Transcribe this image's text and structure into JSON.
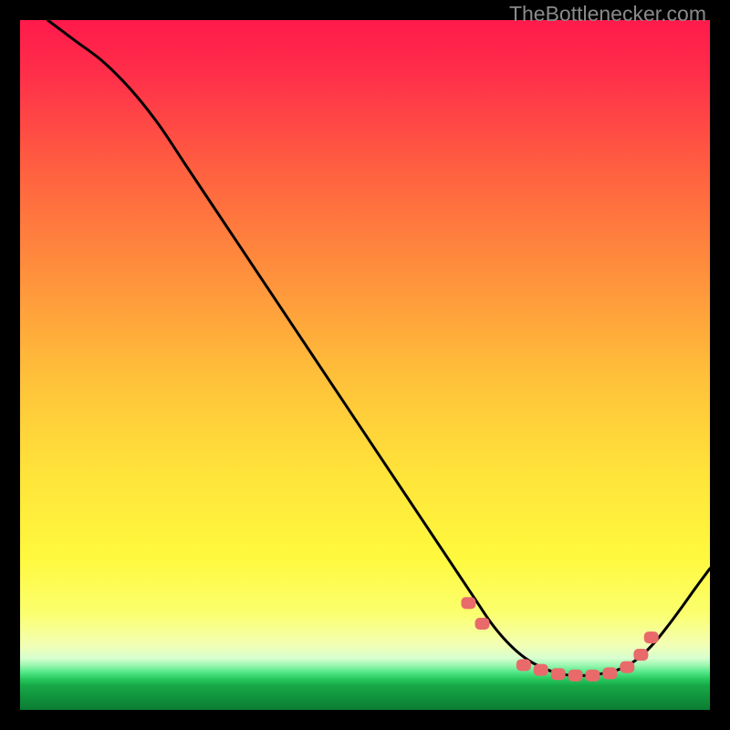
{
  "watermark": "TheBottlenecker.com",
  "colors": {
    "bg": "#000000",
    "grad_top": "#ff1a4b",
    "grad_mid1": "#ff6b3d",
    "grad_mid2": "#ffd23a",
    "grad_mid3": "#fff93e",
    "grad_low": "#f6ffc2",
    "grad_band": "#2fe07a",
    "grad_bottom": "#0c8f3e",
    "curve": "#000000",
    "markers": "#e96a6a"
  },
  "chart_data": {
    "type": "line",
    "title": "",
    "xlabel": "",
    "ylabel": "",
    "xlim": [
      0,
      100
    ],
    "ylim": [
      0,
      100
    ],
    "grid": false,
    "series": [
      {
        "name": "bottleneck-curve",
        "x": [
          4,
          8,
          12,
          16,
          20,
          24,
          28,
          32,
          36,
          40,
          44,
          48,
          52,
          56,
          60,
          64,
          66,
          68,
          70,
          72,
          74,
          76,
          78,
          80,
          82,
          84,
          86,
          88,
          90,
          92,
          94,
          96,
          98,
          100
        ],
        "y": [
          100,
          97,
          94,
          90,
          85,
          79,
          73,
          67,
          61,
          55,
          49,
          43,
          37,
          31,
          25,
          19,
          16,
          13,
          10.5,
          8.5,
          7,
          6,
          5.3,
          5,
          5,
          5.2,
          5.6,
          6.4,
          7.8,
          9.8,
          12.3,
          15,
          17.8,
          20.5
        ]
      }
    ],
    "markers": {
      "shape": "rounded-rect",
      "color": "#e96a6a",
      "x": [
        65,
        67,
        73,
        75.5,
        78,
        80.5,
        83,
        85.5,
        88,
        90,
        91.5
      ],
      "y": [
        15.5,
        12.5,
        6.5,
        5.8,
        5.2,
        5.0,
        5.0,
        5.3,
        6.2,
        8,
        10.5
      ]
    }
  }
}
